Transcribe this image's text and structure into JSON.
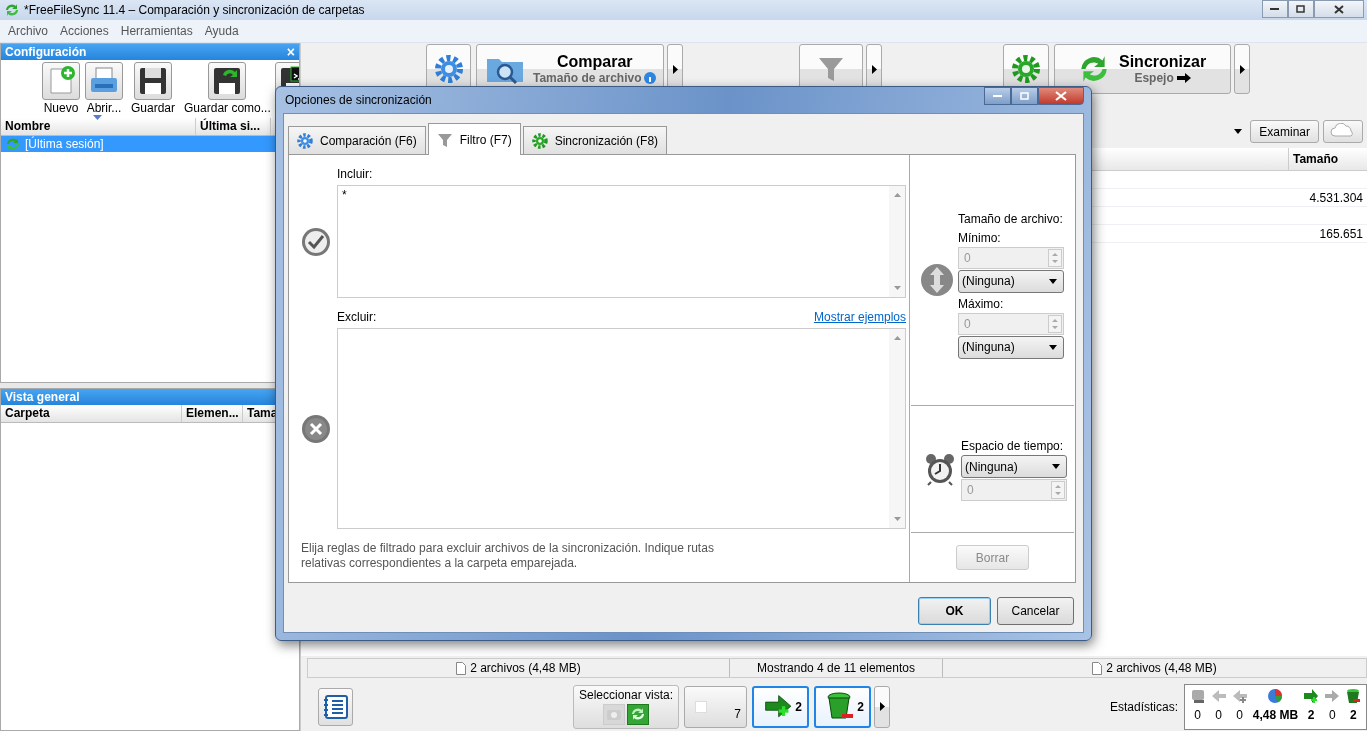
{
  "window": {
    "title": "*FreeFileSync 11.4 – Comparación y sincronización de carpetas"
  },
  "menu": [
    "Archivo",
    "Acciones",
    "Herramientas",
    "Ayuda"
  ],
  "config_panel": {
    "title": "Configuración",
    "close": "×",
    "toolbar": [
      {
        "label": "Nuevo",
        "kind": "new"
      },
      {
        "label": "Abrir...",
        "kind": "open"
      },
      {
        "label": "Guardar",
        "kind": "save"
      },
      {
        "label": "Guardar como...",
        "kind": "save-as"
      },
      {
        "kind": "batch"
      }
    ],
    "columns": [
      "Nombre",
      "Última si..."
    ],
    "items": [
      {
        "label": "[Última sesión]",
        "selected": true
      }
    ]
  },
  "overview_panel": {
    "title": "Vista general",
    "columns": [
      "Carpeta",
      "Elemen...",
      "Tama"
    ]
  },
  "main_toolbar": {
    "compare": {
      "label": "Comparar",
      "variant": "Tamaño de archivo"
    },
    "sync": {
      "label": "Sincronizar",
      "variant": "Espejo"
    }
  },
  "folder_bar": {
    "browse": "Examinar"
  },
  "grid": {
    "column": "Tamaño",
    "rows": [
      {
        "size": "4.531.304"
      },
      {
        "size": "165.651"
      }
    ]
  },
  "status_bar": {
    "left": "2 archivos (4,48 MB)",
    "center": "Mostrando 4 de 11 elementos",
    "right": "2 archivos (4,48 MB)"
  },
  "bottom_bar": {
    "view_label": "Seleccionar vista:",
    "view_buttons": [
      {
        "kind": "folder",
        "selected": false
      },
      {
        "kind": "sync",
        "selected": true
      }
    ],
    "filters": [
      {
        "kind": "equal",
        "count": "7",
        "selected": false
      },
      {
        "kind": "create",
        "count": "2",
        "selected": true
      },
      {
        "kind": "delete",
        "count": "2",
        "selected": true
      }
    ],
    "stats_label": "Estadísticas:",
    "stats": [
      {
        "kind": "disk",
        "value": "0"
      },
      {
        "kind": "left",
        "value": "0"
      },
      {
        "kind": "left-plus",
        "value": "0"
      },
      {
        "kind": "pie",
        "value": "4,48 MB"
      },
      {
        "kind": "create",
        "value": "2"
      },
      {
        "kind": "right",
        "value": "0"
      },
      {
        "kind": "trash",
        "value": "2"
      }
    ]
  },
  "dialog": {
    "title": "Opciones de sincronización",
    "tabs": [
      {
        "label": "Comparación (F6)",
        "kind": "compare",
        "selected": false
      },
      {
        "label": "Filtro (F7)",
        "kind": "filter",
        "selected": true
      },
      {
        "label": "Sincronización (F8)",
        "kind": "sync",
        "selected": false
      }
    ],
    "include": {
      "label": "Incluir:",
      "value": "*"
    },
    "exclude": {
      "label": "Excluir:",
      "link": "Mostrar ejemplos"
    },
    "hint": "Elija reglas de filtrado para excluir archivos de la sincronización. Indique rutas relativas correspondientes a la carpeta emparejada.",
    "size": {
      "label": "Tamaño de archivo:",
      "min": {
        "label": "Mínimo:",
        "value": "0",
        "disabled": true,
        "unit": "(Ninguna)"
      },
      "max": {
        "label": "Máximo:",
        "value": "0",
        "disabled": true,
        "unit": "(Ninguna)"
      }
    },
    "time": {
      "label": "Espacio de tiempo:",
      "unit": "(Ninguna)",
      "value": "0",
      "disabled": true
    },
    "clear": {
      "label": "Borrar",
      "disabled": true
    },
    "ok": "OK",
    "cancel": "Cancelar"
  }
}
